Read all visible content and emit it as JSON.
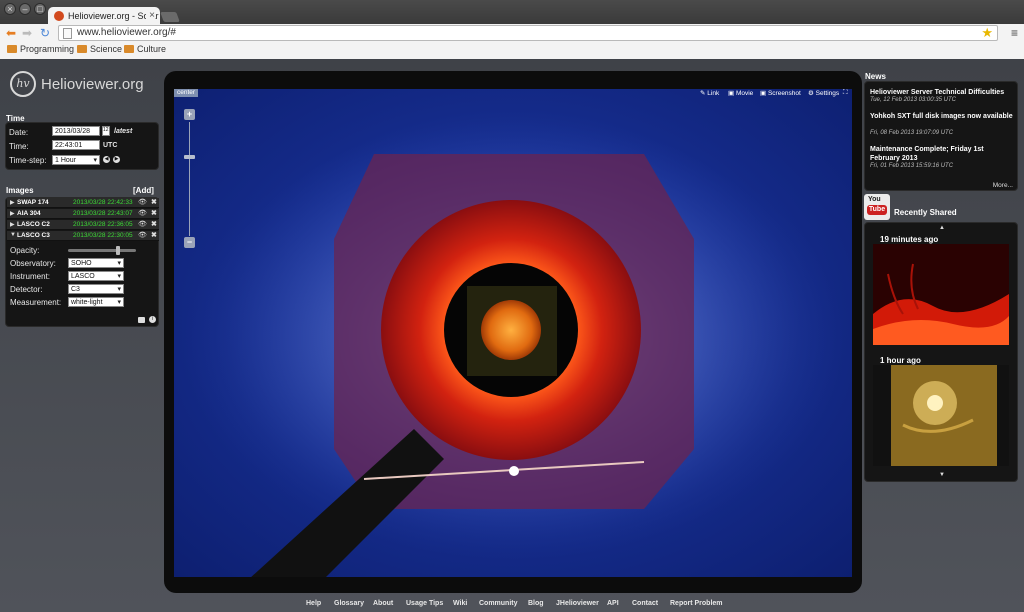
{
  "browser": {
    "tab_title": "Helioviewer.org - Solar an",
    "url": "www.helioviewer.org/#",
    "bookmarks": [
      "Programming",
      "Science",
      "Culture"
    ]
  },
  "site": {
    "logo_text": "Helioviewer.org",
    "logo_mark": "hv"
  },
  "time": {
    "title": "Time",
    "date_label": "Date:",
    "date_value": "2013/03/28",
    "calendar_day": "12",
    "latest": "latest",
    "time_label": "Time:",
    "time_value": "22:43:01",
    "tz": "UTC",
    "step_label": "Time-step:",
    "step_value": "1 Hour"
  },
  "images": {
    "title": "Images",
    "add": "[Add]",
    "layers": [
      {
        "name": "SWAP 174",
        "timestamp": "2013/03/28 22:42:33"
      },
      {
        "name": "AIA 304",
        "timestamp": "2013/03/28 22:43:07"
      },
      {
        "name": "LASCO C2",
        "timestamp": "2013/03/28 22:36:05"
      },
      {
        "name": "LASCO C3",
        "timestamp": "2013/03/28 22:30:05"
      }
    ],
    "details": {
      "opacity_label": "Opacity:",
      "opacity": 0.75,
      "observatory_label": "Observatory:",
      "observatory": "SOHO",
      "instrument_label": "Instrument:",
      "instrument": "LASCO",
      "detector_label": "Detector:",
      "detector": "C3",
      "measurement_label": "Measurement:",
      "measurement": "white-light"
    }
  },
  "viewer": {
    "center": "center",
    "tools": [
      "Link",
      "Movie",
      "Screenshot",
      "Settings"
    ],
    "zoom_level": 0.7
  },
  "news": {
    "title": "News",
    "items": [
      {
        "headline": "Helioviewer Server Technical Difficulties",
        "date": "Tue, 12 Feb 2013 03:00:35 UTC"
      },
      {
        "headline": "Yohkoh SXT full disk images now available",
        "date": "Fri, 08 Feb 2013 19:07:09 UTC"
      },
      {
        "headline": "Maintenance Complete; Friday 1st February 2013",
        "date": "Fri, 01 Feb 2013 15:59:16 UTC"
      }
    ],
    "more": "More..."
  },
  "shared": {
    "youtube_label": "You",
    "youtube_tube": "Tube",
    "title": "Recently Shared",
    "items": [
      {
        "ago": "19 minutes ago"
      },
      {
        "ago": "1 hour ago"
      }
    ]
  },
  "footer": [
    "Help",
    "Glossary",
    "About",
    "Usage Tips",
    "Wiki",
    "Community",
    "Blog",
    "JHelioviewer",
    "API",
    "Contact",
    "Report Problem"
  ],
  "colors": {
    "timestamp_green": "#3ddc36",
    "accent_blue": "#7e8fb0"
  }
}
